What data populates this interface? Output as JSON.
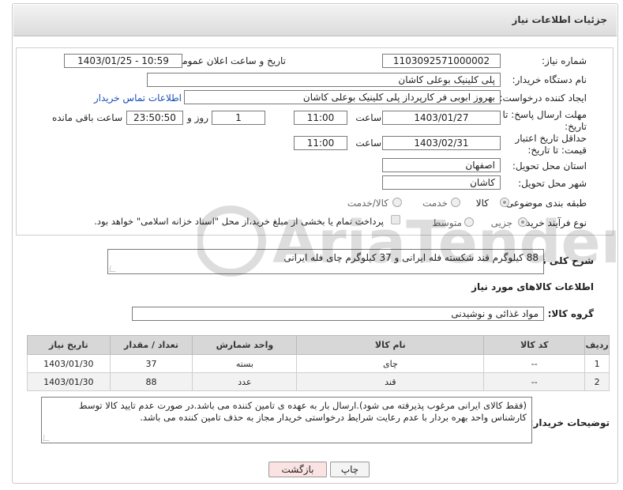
{
  "header": {
    "title": "جزئیات اطلاعات نیاز"
  },
  "form": {
    "need_number": {
      "label": "شماره نیاز:",
      "value": "1103092571000002"
    },
    "announce_datetime": {
      "label": "تاریخ و ساعت اعلان عمومی:",
      "value": "1403/01/25 - 10:59"
    },
    "buyer_org": {
      "label": "نام دستگاه خریدار:",
      "value": "پلی کلینیک بوعلی کاشان"
    },
    "requester": {
      "label": "ایجاد کننده درخواست:",
      "value": "بهروز ابوبی فر کارپرداز پلی کلینیک بوعلی کاشان",
      "contact_link": "اطلاعات تماس خریدار"
    },
    "reply_deadline": {
      "label": "مهلت ارسال پاسخ: تا تاریخ:",
      "date": "1403/01/27",
      "time_label": "ساعت",
      "time": "11:00",
      "days": "1",
      "days_label": "روز و",
      "remaining": "23:50:50",
      "remaining_label": "ساعت باقی مانده"
    },
    "price_validity": {
      "label": "حداقل تاریخ اعتبار قیمت: تا تاریخ:",
      "date": "1403/02/31",
      "time_label": "ساعت",
      "time": "11:00"
    },
    "province": {
      "label": "استان محل تحویل:",
      "value": "اصفهان"
    },
    "city": {
      "label": "شهر محل تحویل:",
      "value": "کاشان"
    },
    "category": {
      "label": "طبقه بندی موضوعی:",
      "options": [
        "کالا",
        "خدمت",
        "کالا/خدمت"
      ],
      "selected": "کالا"
    },
    "purchase_type": {
      "label": "نوع فرآیند خرید :",
      "options": [
        "جزیی",
        "متوسط"
      ],
      "selected": "جزیی",
      "note": "پرداخت تمام یا بخشی از مبلغ خرید،از محل \"اسناد خزانه اسلامی\" خواهد بود."
    }
  },
  "description": {
    "label": "شرح کلی نیاز:",
    "value": "88 کیلوگرم قند شکسته فله ایرانی و 37 کیلوگرم چای فله ایرانی"
  },
  "items_section": {
    "title": "اطلاعات کالاهای مورد نیاز",
    "group_label": "گروه کالا:",
    "group_value": "مواد غذائی و نوشیدنی",
    "columns": [
      "ردیف",
      "کد کالا",
      "نام کالا",
      "واحد شمارش",
      "تعداد / مقدار",
      "تاریخ نیاز"
    ],
    "rows": [
      [
        "1",
        "--",
        "چای",
        "بسته",
        "37",
        "1403/01/30"
      ],
      [
        "2",
        "--",
        "قند",
        "عدد",
        "88",
        "1403/01/30"
      ]
    ]
  },
  "buyer_notes": {
    "label": "توضیحات خریدار:",
    "value": "(فقط کالای ایرانی مرغوب پذیرفته می شود).ارسال بار به عهده ی تامین کننده می باشد.در صورت عدم تایید کالا توسط کارشناس واحد بهره بردار با عدم رعایت شرایط درخواستی خریدار مجاز به حذف تامین کننده می باشد."
  },
  "buttons": {
    "print": "چاپ",
    "back": "بازگشت"
  },
  "watermark": {
    "text": "AriaTender.net"
  },
  "colors": {
    "link": "#1a4fb5",
    "back_button_bg": "#fbe3e3",
    "header_bg": "#e2e2e2"
  }
}
